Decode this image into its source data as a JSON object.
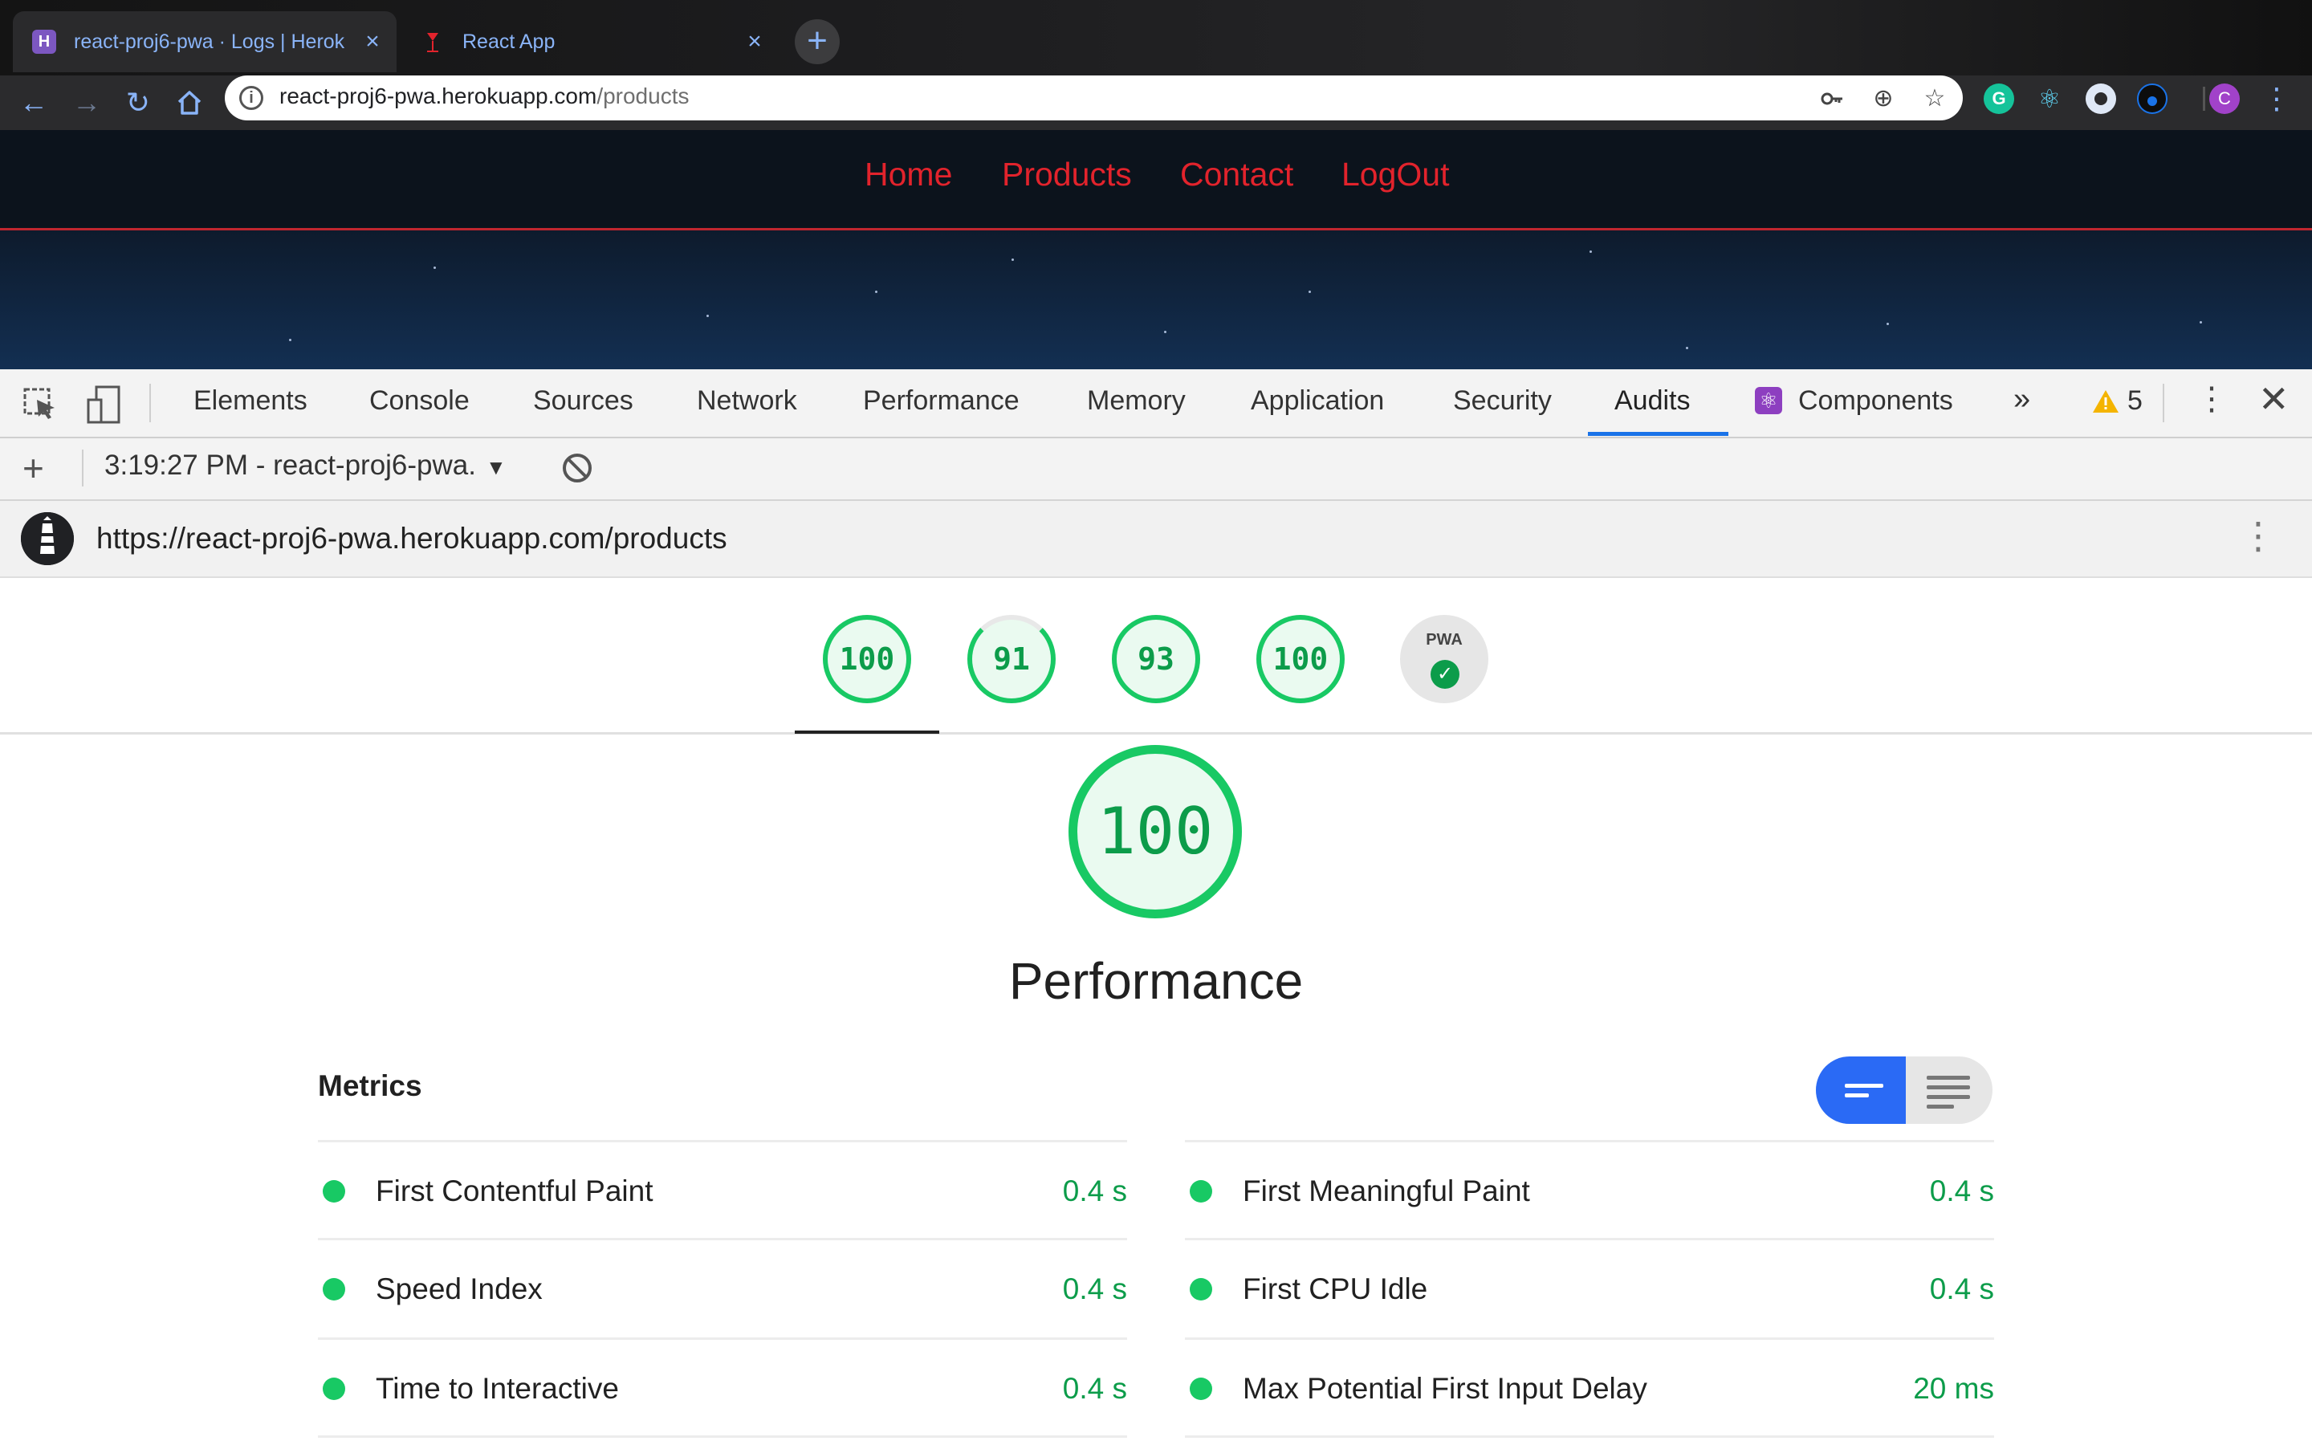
{
  "browser": {
    "tabs": [
      {
        "title": "react-proj6-pwa · Logs | Herok",
        "active": true
      },
      {
        "title": "React App",
        "active": false
      }
    ],
    "new_tab_glyph": "+",
    "url": {
      "host": "react-proj6-pwa.herokuapp.com",
      "path": "/products"
    },
    "profile_initial": "C"
  },
  "site": {
    "nav": [
      "Home",
      "Products",
      "Contact",
      "LogOut"
    ],
    "nav_color": "#e2232c"
  },
  "devtools": {
    "tabs": [
      "Elements",
      "Console",
      "Sources",
      "Network",
      "Performance",
      "Memory",
      "Application",
      "Security",
      "Audits",
      "Components"
    ],
    "active_tab": "Audits",
    "overflow": "»",
    "warnings_count": "5",
    "report_select": "3:19:27 PM - react-proj6-pwa.",
    "report_url": "https://react-proj6-pwa.herokuapp.com/products"
  },
  "audit": {
    "scores": [
      "100",
      "91",
      "93",
      "100"
    ],
    "pwa_label": "PWA",
    "category_score": "100",
    "category_title": "Performance",
    "metrics_title": "Metrics",
    "metrics": [
      {
        "label": "First Contentful Paint",
        "value": "0.4 s"
      },
      {
        "label": "First Meaningful Paint",
        "value": "0.4 s"
      },
      {
        "label": "Speed Index",
        "value": "0.4 s"
      },
      {
        "label": "First CPU Idle",
        "value": "0.4 s"
      },
      {
        "label": "Time to Interactive",
        "value": "0.4 s"
      },
      {
        "label": "Max Potential First Input Delay",
        "value": "20 ms"
      }
    ],
    "pass_color": "#18c964"
  }
}
